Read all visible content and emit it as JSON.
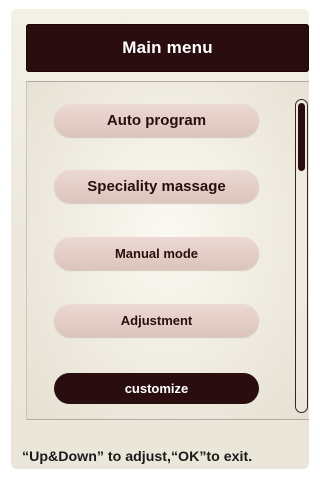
{
  "title": "Main menu",
  "menu": {
    "items": [
      {
        "label": "Auto program"
      },
      {
        "label": "Speciality massage"
      },
      {
        "label": "Manual mode"
      },
      {
        "label": "Adjustment"
      },
      {
        "label": "customize",
        "selected": true
      }
    ]
  },
  "scrollbar": {
    "thumb_position_fraction": 0.0,
    "thumb_size_fraction": 0.22
  },
  "hint_text": "“Up&Down” to adjust,“OK”to exit.",
  "colors": {
    "accent_dark": "#2a0e0f",
    "item_background": "#e2cdc6",
    "panel_background": "#efebe0",
    "active_text": "#ffffff"
  }
}
